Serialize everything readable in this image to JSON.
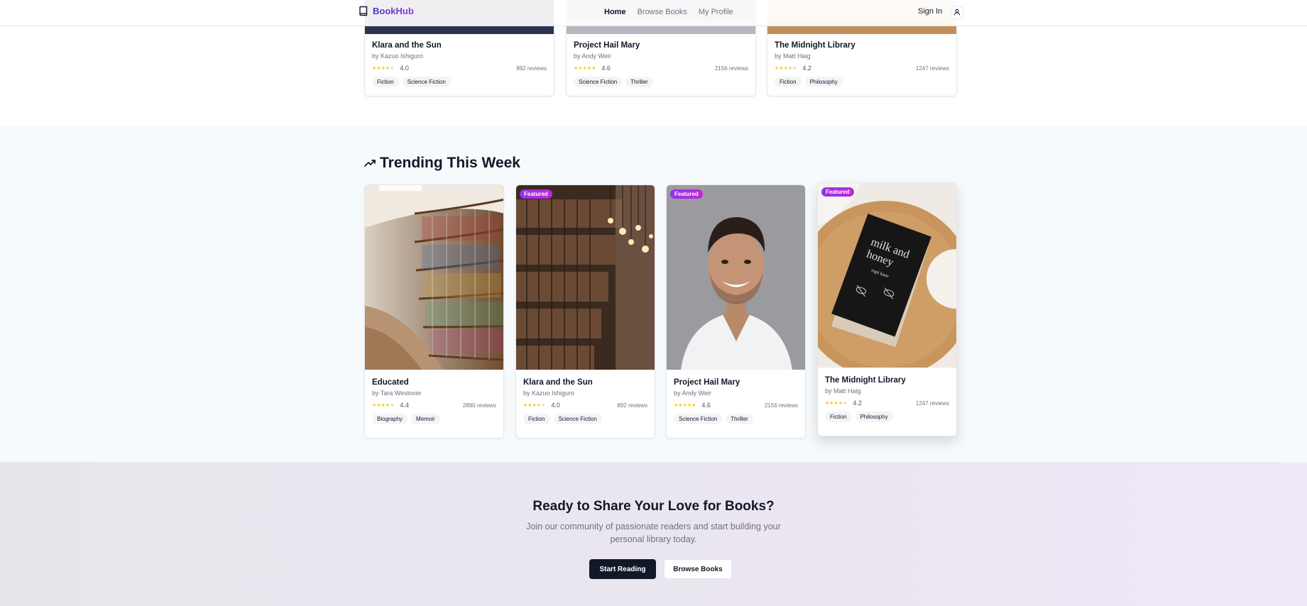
{
  "nav": {
    "brand": "BookHub",
    "links": [
      {
        "label": "Home",
        "active": true
      },
      {
        "label": "Browse Books",
        "active": false
      },
      {
        "label": "My Profile",
        "active": false
      }
    ],
    "sign_in": "Sign In"
  },
  "top_row": [
    {
      "title": "Klara and the Sun",
      "author": "by Kazuo Ishiguro",
      "rating": "4.0",
      "stars": 4,
      "reviews": "892 reviews",
      "tags": [
        "Fiction",
        "Science Fiction"
      ]
    },
    {
      "title": "Project Hail Mary",
      "author": "by Andy Weir",
      "rating": "4.6",
      "stars": 5,
      "reviews": "2156 reviews",
      "tags": [
        "Science Fiction",
        "Thriller"
      ]
    },
    {
      "title": "The Midnight Library",
      "author": "by Matt Haig",
      "rating": "4.2",
      "stars": 4,
      "reviews": "1247 reviews",
      "tags": [
        "Fiction",
        "Philosophy"
      ]
    }
  ],
  "trending": {
    "title": "Trending This Week",
    "badge_label": "Featured",
    "books": [
      {
        "title": "Educated",
        "author": "by Tara Westover",
        "rating": "4.4",
        "stars": 4,
        "reviews": "2890 reviews",
        "tags": [
          "Biography",
          "Memoir"
        ],
        "featured": false
      },
      {
        "title": "Klara and the Sun",
        "author": "by Kazuo Ishiguro",
        "rating": "4.0",
        "stars": 4,
        "reviews": "892 reviews",
        "tags": [
          "Fiction",
          "Science Fiction"
        ],
        "featured": true
      },
      {
        "title": "Project Hail Mary",
        "author": "by Andy Weir",
        "rating": "4.6",
        "stars": 5,
        "reviews": "2156 reviews",
        "tags": [
          "Science Fiction",
          "Thriller"
        ],
        "featured": true
      },
      {
        "title": "The Midnight Library",
        "author": "by Matt Haig",
        "rating": "4.2",
        "stars": 4,
        "reviews": "1247 reviews",
        "tags": [
          "Fiction",
          "Philosophy"
        ],
        "featured": true
      }
    ]
  },
  "cta": {
    "title": "Ready to Share Your Love for Books?",
    "subtitle": "Join our community of passionate readers and start building your personal library today.",
    "primary_button": "Start Reading",
    "secondary_button": "Browse Books"
  },
  "colors": {
    "brand_start": "#4338ca",
    "brand_end": "#9333ea",
    "star": "#facc15",
    "badge": "#9333ea",
    "dark_button": "#111827"
  },
  "icons": {
    "brand": "book-icon",
    "profile": "user-icon",
    "trending": "trending-up-icon",
    "star": "star-icon"
  }
}
